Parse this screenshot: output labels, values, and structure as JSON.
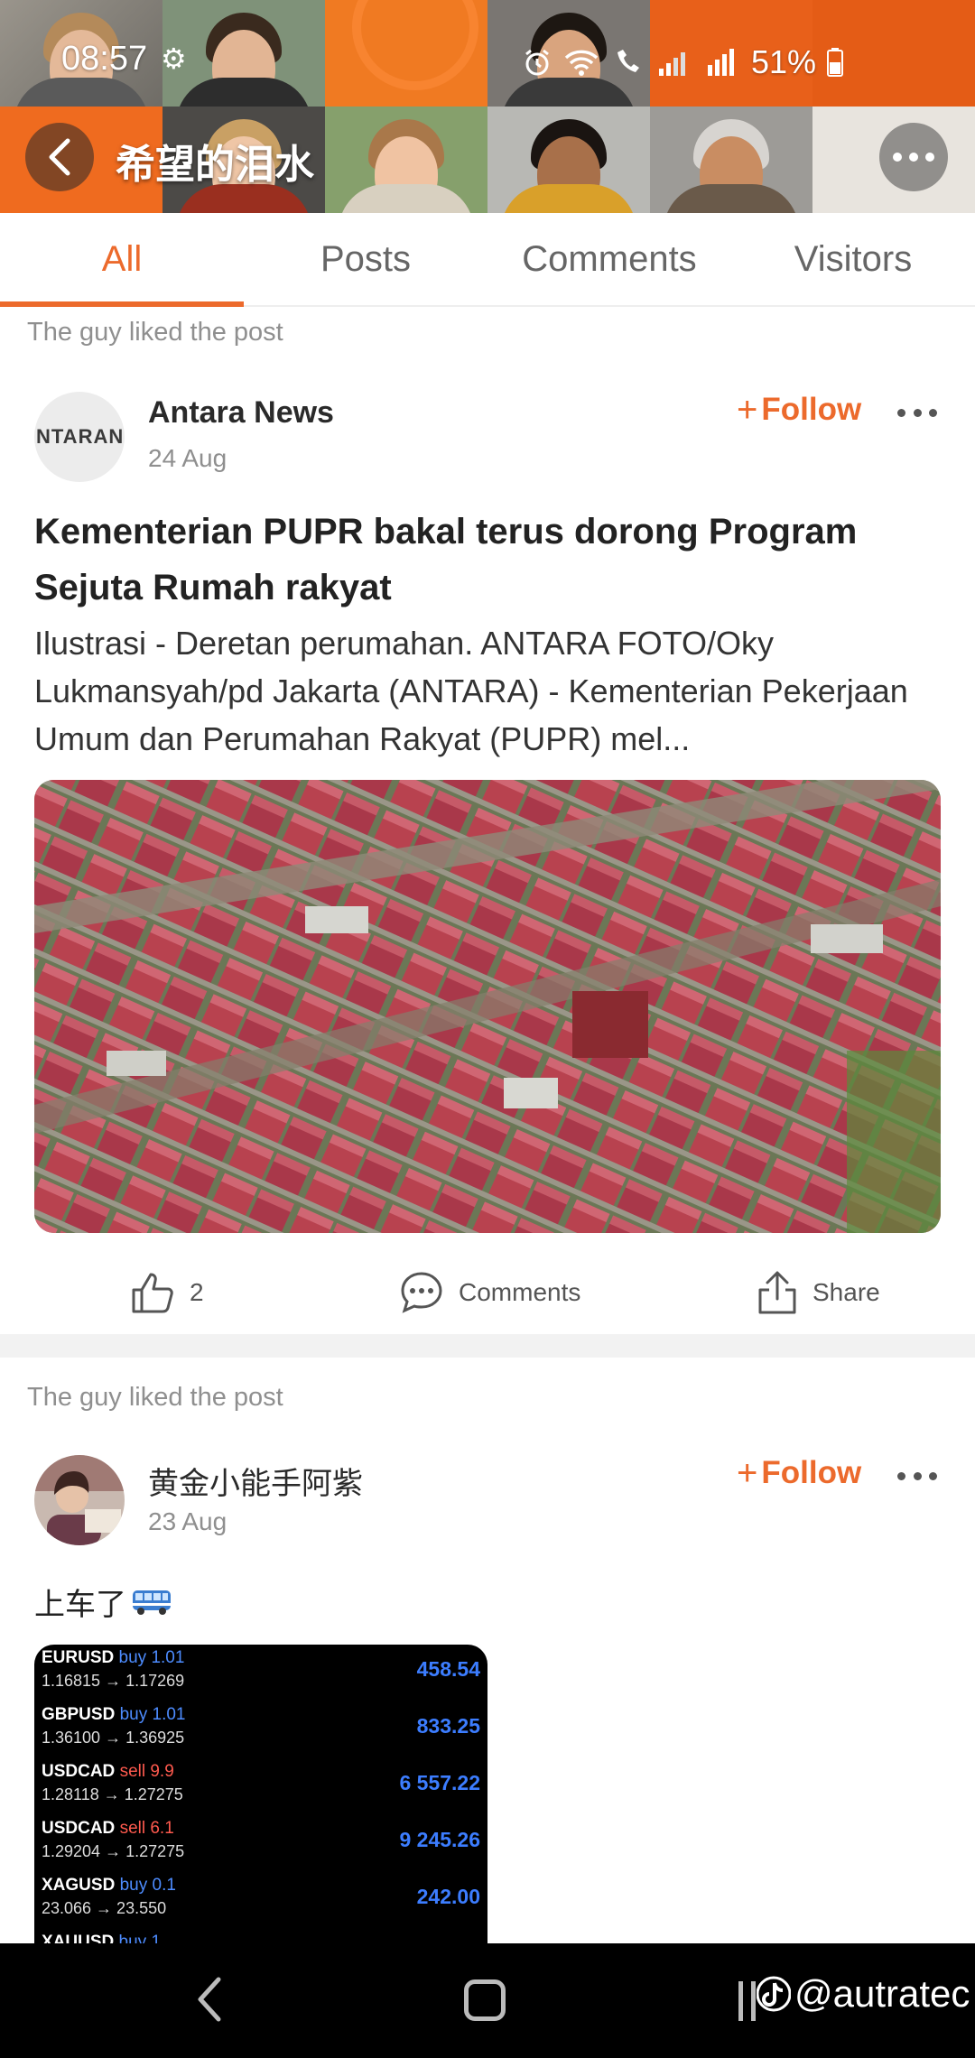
{
  "status_bar": {
    "time": "08:57",
    "battery": "51%"
  },
  "header": {
    "title": "希望的泪水",
    "back_icon": "chevron-left-icon",
    "more_icon": "more-horizontal-icon"
  },
  "tabs": [
    {
      "label": "All",
      "active": true
    },
    {
      "label": "Posts",
      "active": false
    },
    {
      "label": "Comments",
      "active": false
    },
    {
      "label": "Visitors",
      "active": false
    }
  ],
  "posts": [
    {
      "activity": "The guy liked the post",
      "author": "Antara News",
      "avatar_text": "ANTARANE",
      "date": "24 Aug",
      "follow_label": "Follow",
      "title": "Kementerian PUPR bakal terus dorong Program Sejuta Rumah rakyat",
      "excerpt": "Ilustrasi - Deretan perumahan. ANTARA FOTO/Oky Lukmansyah/pd Jakarta (ANTARA) - Kementerian Pekerjaan Umum dan Perumahan Rakyat (PUPR) mel...",
      "likes": "2",
      "comments_label": "Comments",
      "share_label": "Share"
    },
    {
      "activity": "The guy liked the post",
      "author": "黄金小能手阿紫",
      "date": "23 Aug",
      "follow_label": "Follow",
      "text": "上车了",
      "text_icon": "bus-icon",
      "trades": [
        {
          "symbol": "EURUSD",
          "side": "buy",
          "lot": "1.01",
          "rates": "1.16815 → 1.17269",
          "profit": "458.54"
        },
        {
          "symbol": "GBPUSD",
          "side": "buy",
          "lot": "1.01",
          "rates": "1.36100 → 1.36925",
          "profit": "833.25"
        },
        {
          "symbol": "USDCAD",
          "side": "sell",
          "lot": "9.9",
          "rates": "1.28118 → 1.27275",
          "profit": "6 557.22"
        },
        {
          "symbol": "USDCAD",
          "side": "sell",
          "lot": "6.1",
          "rates": "1.29204 → 1.27275",
          "profit": "9 245.26"
        },
        {
          "symbol": "XAGUSD",
          "side": "buy",
          "lot": "0.1",
          "rates": "23.066 → 23.550",
          "profit": "242.00"
        },
        {
          "symbol": "XAUUSD",
          "side": "buy",
          "lot": "1",
          "rates": "",
          "profit": ""
        }
      ]
    }
  ],
  "nav_bar": {
    "watermark": "@autratec"
  },
  "colors": {
    "accent": "#ec6a2c",
    "header_orange": "#e9621a",
    "trade_buy": "#4d8cff",
    "trade_sell": "#ff5a4e",
    "trade_profit": "#3c7dff"
  }
}
